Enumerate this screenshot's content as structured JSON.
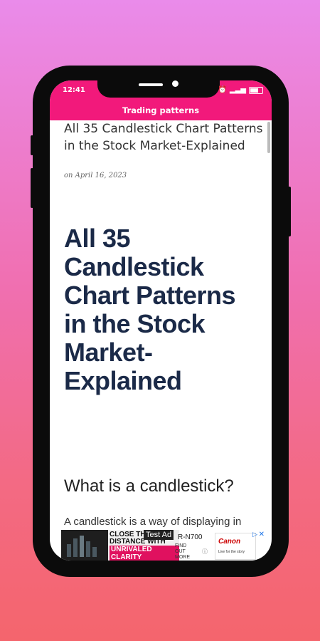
{
  "status_bar": {
    "time": "12:41",
    "battery_icon": "battery-icon"
  },
  "app_bar": {
    "title": "Trading patterns"
  },
  "post": {
    "title": "All 35 Candlestick Chart Patterns in the Stock Market-Explained",
    "date": "on April 16, 2023"
  },
  "article": {
    "heading": "All 35 Candlestick Chart Patterns in the Stock Market-Explained",
    "subheading": "What is a candlestick?",
    "paragraph_start": "A candlestick is a way of displaying in"
  },
  "ad": {
    "headline_1": "CLOSE THE",
    "headline_2": "DISTANCE WITH",
    "headline_3": "UNRIVALED CLARITY",
    "test_label": "Test Ad",
    "model": "R-N700",
    "find_out_more": "FIND OUT MORE",
    "brand": "Canon",
    "tagline": "Live for the story",
    "adchoices_icon": "adchoices-icon",
    "close_icon": "close-icon"
  },
  "colors": {
    "brand_pink": "#f2197b",
    "heading_navy": "#1b2a48"
  }
}
